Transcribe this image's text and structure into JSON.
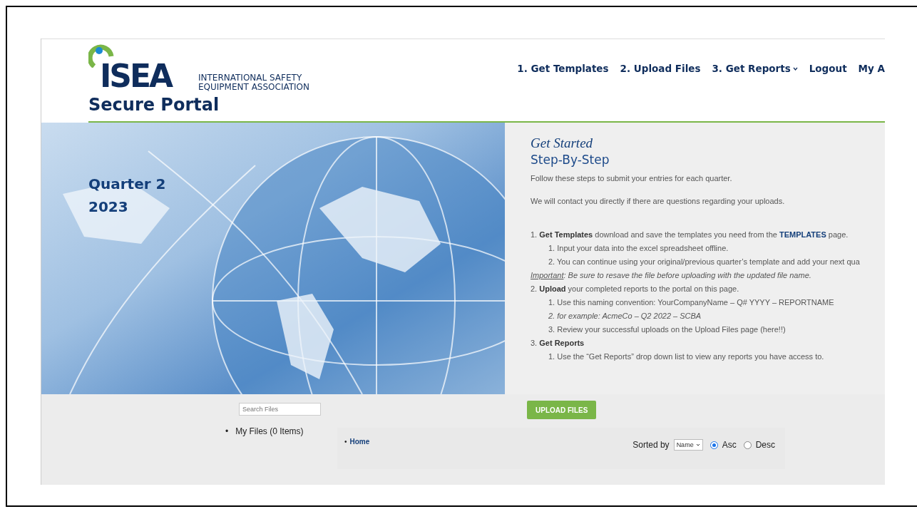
{
  "logo": {
    "mark": "ISEA",
    "org_line1": "INTERNATIONAL SAFETY",
    "org_line2": "EQUIPMENT ASSOCIATION",
    "subtitle": "Secure Portal"
  },
  "nav": [
    {
      "label": "1. Get Templates",
      "dropdown": false
    },
    {
      "label": "2. Upload Files",
      "dropdown": false
    },
    {
      "label": "3. Get Reports",
      "dropdown": true
    },
    {
      "label": "Logout",
      "dropdown": false
    },
    {
      "label": "My A",
      "dropdown": false
    }
  ],
  "hero": {
    "title_lines": [
      "Quarter 2",
      "2023"
    ]
  },
  "intro": {
    "script_heading": "Get Started",
    "heading": "Step-By-Step",
    "paragraphs": [
      "Follow these steps to submit your entries for each quarter.",
      "We will contact you directly if there are questions regarding your uploads."
    ]
  },
  "steps": [
    {
      "kind": "step",
      "number": "1.",
      "title": "Get Templates",
      "text": " download and save the templates you need from the ",
      "link": "TEMPLATES",
      "text_after": " page.",
      "children": [
        {
          "number": "1.",
          "text": "Input your data into the excel spreadsheet offline.",
          "italic": false
        },
        {
          "number": "2.",
          "text": "You can continue using your original/previous quarter’s template and add your next qua",
          "italic": false
        }
      ]
    },
    {
      "kind": "note",
      "label": "Important",
      "text": ":  Be sure to resave the file before uploading with the updated file name."
    },
    {
      "kind": "step",
      "number": "2.",
      "title": "Upload",
      "text": " your completed reports to the portal on this page.",
      "children": [
        {
          "number": "1.",
          "text": "Use this naming convention: YourCompanyName – Q# YYYY – REPORTNAME",
          "italic": false
        },
        {
          "number": "2.",
          "text": "for example: AcmeCo – Q2 2022 – SCBA",
          "italic": true
        },
        {
          "number": "3.",
          "text": "Review your successful uploads on the Upload Files page (here!!)",
          "italic": false
        }
      ]
    },
    {
      "kind": "step",
      "number": "3.",
      "title": "Get Reports",
      "children": [
        {
          "number": "1.",
          "text": "Use the “Get Reports” drop down list to view any reports you have access to.",
          "italic": false
        }
      ]
    }
  ],
  "files": {
    "search_placeholder": "Search Files",
    "tree": [
      {
        "bullet": "•",
        "label": "My Files (0 Items)"
      }
    ],
    "breadcrumb": [
      {
        "bullet": "•",
        "label": "Home"
      }
    ],
    "upload_button": "UPLOAD FILES",
    "sort_label": "Sorted by",
    "sort_value": "Name",
    "sort_options": [
      {
        "label": "Asc",
        "selected": true
      },
      {
        "label": "Desc",
        "selected": false
      }
    ]
  }
}
